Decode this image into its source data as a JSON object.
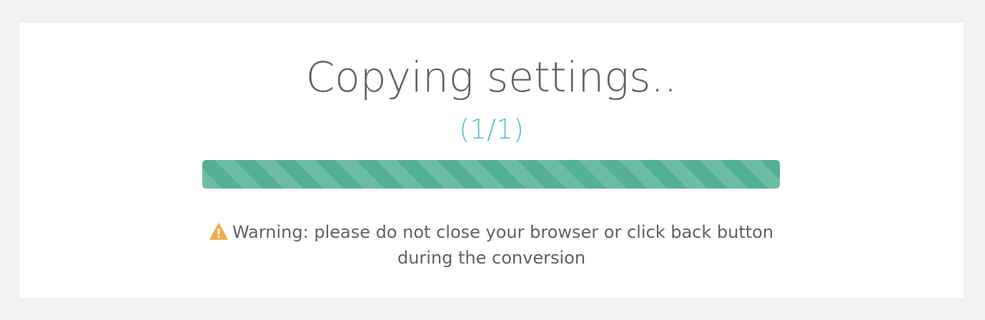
{
  "progress": {
    "title": "Copying settings..",
    "counter": "(1/1)",
    "fraction": 1.0,
    "bar_color": "#54b095",
    "counter_color": "#5bbfc9"
  },
  "warning": {
    "icon": "warning-triangle-icon",
    "icon_color": "#f0ad4e",
    "line1": "Warning: please do not close your browser or click back button",
    "line2": "during the conversion"
  }
}
